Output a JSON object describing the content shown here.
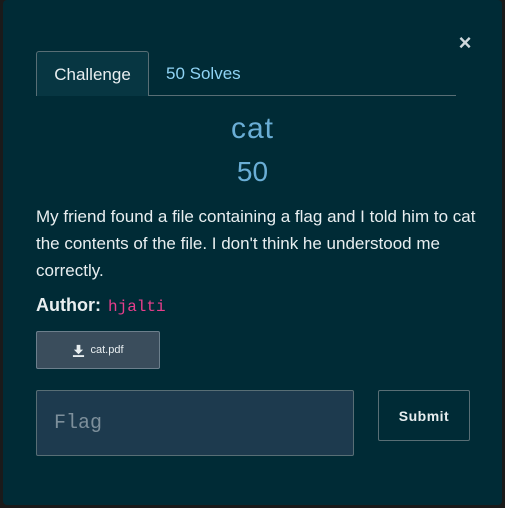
{
  "modal": {
    "close_glyph": "×",
    "tabs": [
      {
        "label": "Challenge"
      },
      {
        "label": "50 Solves"
      }
    ],
    "challenge": {
      "name": "cat",
      "points": "50",
      "description": "My friend found a file containing a flag and I told him to cat the contents of the file. I don't think he understood me correctly.",
      "author_label": "Author:",
      "author_name": "hjalti",
      "file_label": "cat.pdf"
    },
    "form": {
      "flag_placeholder": "Flag",
      "flag_value": "",
      "submit_label": "Submit"
    }
  },
  "colors": {
    "background": "#002b36",
    "title": "#6aaed6",
    "author_name": "#e83e8c",
    "tab_link": "#8fd3f4"
  }
}
